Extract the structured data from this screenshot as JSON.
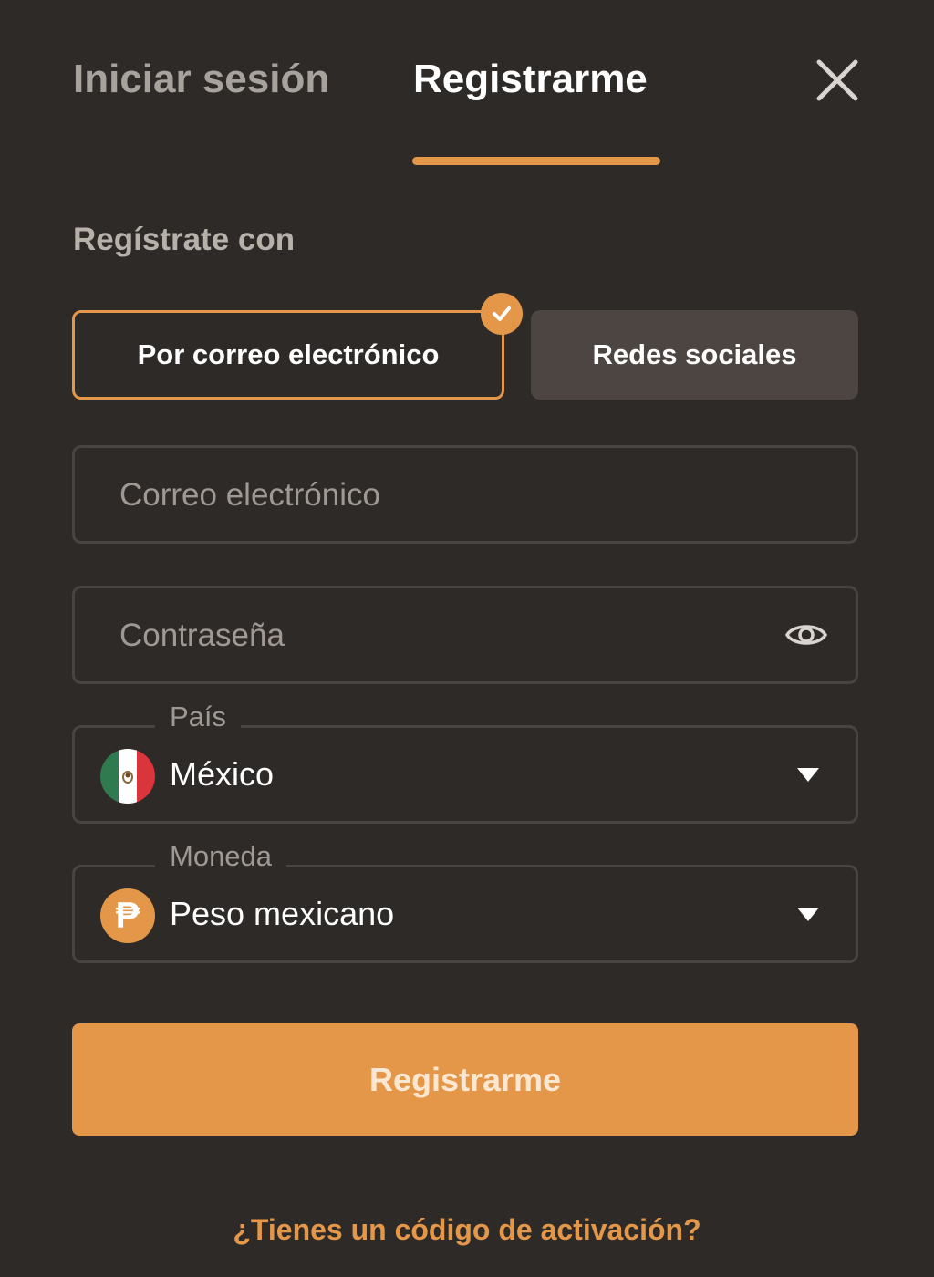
{
  "tabs": {
    "login": "Iniciar sesión",
    "register": "Registrarme"
  },
  "icons": {
    "close": "close-icon",
    "check": "check-icon",
    "eye": "eye-icon",
    "flag": "mexico-flag-icon",
    "currency": "peso-coin-icon",
    "caret": "caret-down-icon"
  },
  "signup": {
    "heading": "Regístrate con",
    "options": {
      "email": "Por correo electrónico",
      "social": "Redes sociales"
    },
    "selected_option": "email"
  },
  "form": {
    "email_placeholder": "Correo electrónico",
    "email_value": "",
    "password_placeholder": "Contraseña",
    "password_value": "",
    "country_label": "País",
    "country_value": "México",
    "currency_label": "Moneda",
    "currency_value": "Peso mexicano",
    "currency_symbol": "₱",
    "submit_label": "Registrarme"
  },
  "footer": {
    "activation_link": "¿Tienes un código de activación?"
  },
  "colors": {
    "background": "#2e2a28",
    "accent": "#e49748",
    "social_button": "#4c4541",
    "field_border": "#4a4440"
  }
}
